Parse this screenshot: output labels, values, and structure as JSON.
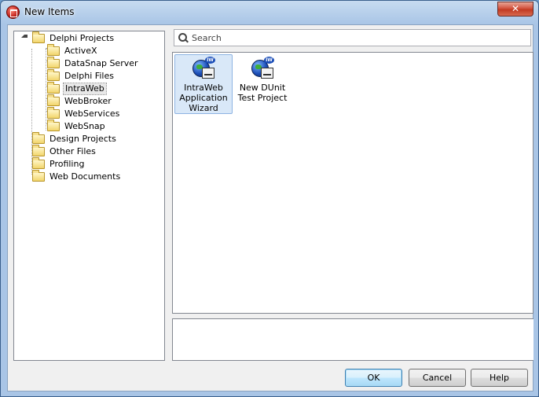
{
  "window": {
    "title": "New Items",
    "close_glyph": "✕"
  },
  "tree": {
    "root": {
      "label": "Delphi Projects",
      "expanded": true
    },
    "children": [
      {
        "label": "ActiveX"
      },
      {
        "label": "DataSnap Server"
      },
      {
        "label": "Delphi Files"
      },
      {
        "label": "IntraWeb",
        "selected": true
      },
      {
        "label": "WebBroker"
      },
      {
        "label": "WebServices"
      },
      {
        "label": "WebSnap"
      }
    ],
    "siblings": [
      {
        "label": "Design Projects"
      },
      {
        "label": "Other Files"
      },
      {
        "label": "Profiling"
      },
      {
        "label": "Web Documents"
      }
    ]
  },
  "search": {
    "placeholder": "Search",
    "value": ""
  },
  "items": [
    {
      "line1": "IntraWeb",
      "line2": "Application",
      "line3": "Wizard",
      "badge": "IW",
      "selected": true
    },
    {
      "line1": "New DUnit",
      "line2": "Test Project",
      "line3": "",
      "badge": "IW",
      "selected": false
    }
  ],
  "buttons": {
    "ok": "OK",
    "cancel": "Cancel",
    "help": "Help"
  },
  "icons": {
    "app": "app-icon",
    "folder": "folder-icon",
    "search": "search-icon",
    "item": "intraweb-wizard-icon"
  }
}
